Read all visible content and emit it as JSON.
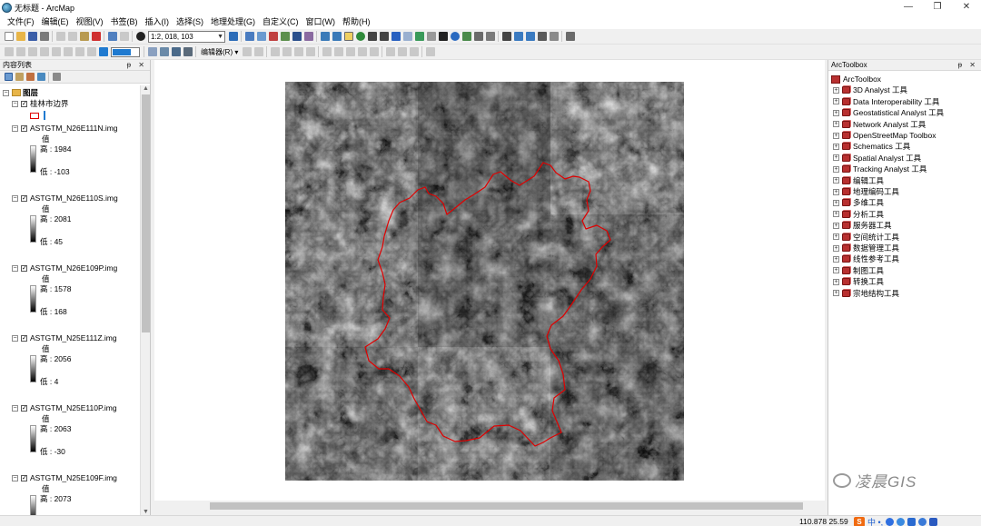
{
  "window": {
    "title": "无标题 - ArcMap",
    "minimize_glyph": "—",
    "restore_glyph": "❐",
    "close_glyph": "✕"
  },
  "menu": [
    "文件(F)",
    "编辑(E)",
    "视图(V)",
    "书签(B)",
    "插入(I)",
    "选择(S)",
    "地理处理(G)",
    "自定义(C)",
    "窗口(W)",
    "帮助(H)"
  ],
  "toolbar": {
    "scale": "1:2, 018, 103",
    "editor_label": "编辑器(R) ▾"
  },
  "toc": {
    "title": "内容列表",
    "pin": "ᵽ ✕",
    "root": "图层",
    "boundary_layer": "桂林市边界",
    "value_label": "值",
    "layers": [
      {
        "name": "ASTGTM_N26E111N.img",
        "high": "高 : 1984",
        "low": "低 : -103"
      },
      {
        "name": "ASTGTM_N26E110S.img",
        "high": "高 : 2081",
        "low": "低 : 45"
      },
      {
        "name": "ASTGTM_N26E109P.img",
        "high": "高 : 1578",
        "low": "低 : 168"
      },
      {
        "name": "ASTGTM_N25E111Z.img",
        "high": "高 : 2056",
        "low": "低 : 4"
      },
      {
        "name": "ASTGTM_N25E110P.img",
        "high": "高 : 2063",
        "low": "低 : -30"
      },
      {
        "name": "ASTGTM_N25E109F.img",
        "high": "高 : 2073",
        "low": ""
      }
    ]
  },
  "arctoolbox": {
    "title": "ArcToolbox",
    "pin": "ᵽ ✕",
    "root": "ArcToolbox",
    "items": [
      "3D Analyst 工具",
      "Data Interoperability 工具",
      "Geostatistical Analyst 工具",
      "Network Analyst 工具",
      "OpenStreetMap Toolbox",
      "Schematics 工具",
      "Spatial Analyst 工具",
      "Tracking Analyst 工具",
      "编辑工具",
      "地理编码工具",
      "多维工具",
      "分析工具",
      "服务器工具",
      "空间统计工具",
      "数据管理工具",
      "线性参考工具",
      "制图工具",
      "转换工具",
      "宗地结构工具"
    ]
  },
  "watermark": "凌晨GIS",
  "status": {
    "coords": "110.878  25.59",
    "ime_logo": "S",
    "ime_chars": "中 •,"
  },
  "colors": {
    "boundary": "#e00000",
    "accent": "#1f7ad0",
    "toolbox_icon": "#b83030"
  }
}
